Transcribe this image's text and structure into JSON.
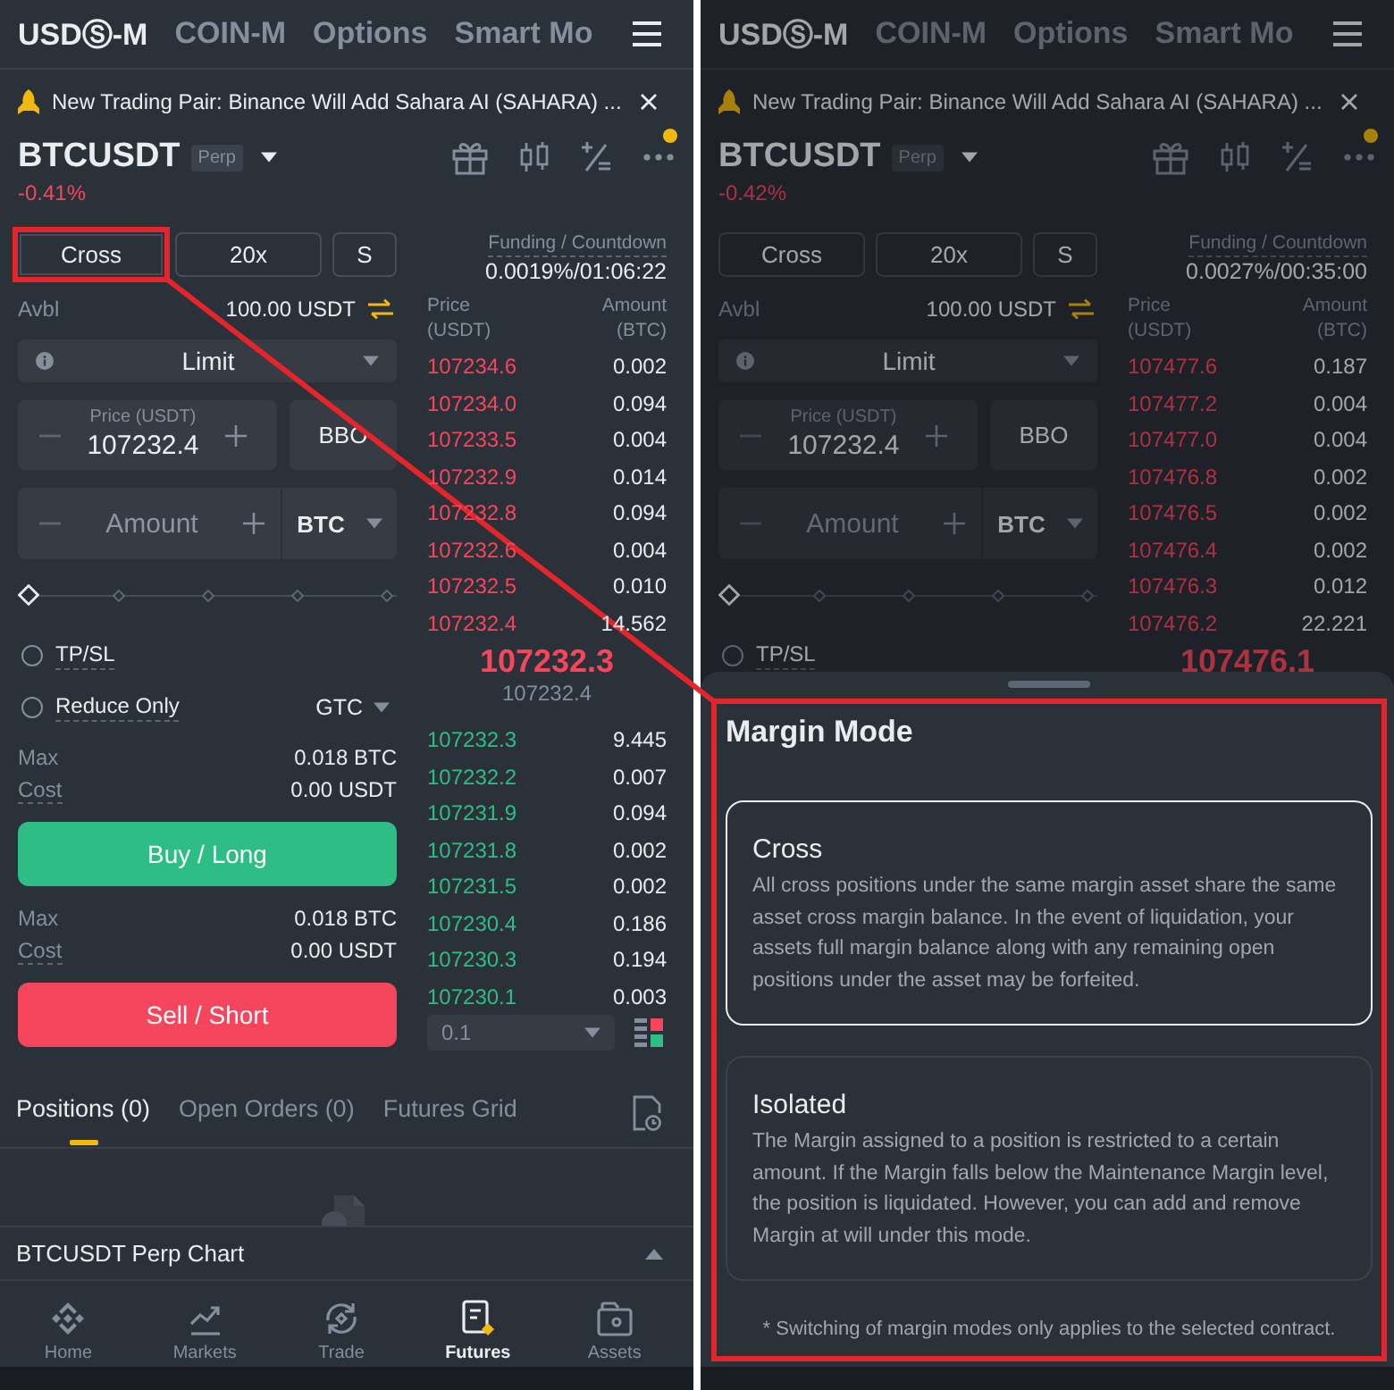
{
  "screens": [
    {
      "top_tabs": [
        {
          "label": "USDⓈ-M",
          "selected": true
        },
        {
          "label": "COIN-M",
          "selected": false
        },
        {
          "label": "Options",
          "selected": false
        },
        {
          "label": "Smart Mo",
          "selected": false
        }
      ],
      "announcement": "New Trading Pair: Binance Will Add Sahara AI (SAHARA) ...",
      "symbol": {
        "name": "BTCUSDT",
        "tag": "Perp",
        "change": "-0.41%"
      },
      "notice_dot": true,
      "margin_buttons": [
        {
          "label": "Cross",
          "highlighted": true
        },
        {
          "label": "20x",
          "highlighted": false
        },
        {
          "label": "S",
          "highlighted": false
        }
      ],
      "funding": {
        "label": "Funding / Countdown",
        "value": "0.0019%/01:06:22"
      },
      "available": {
        "label": "Avbl",
        "value": "100.00 USDT"
      },
      "order_type": "Limit",
      "price_field": {
        "label": "Price (USDT)",
        "value": "107232.4",
        "button": "BBO"
      },
      "amount_field": {
        "placeholder": "Amount",
        "unit": "BTC"
      },
      "slider": {
        "level": 0
      },
      "options": [
        {
          "label": "TP/SL",
          "checked": false
        },
        {
          "label": "Reduce Only",
          "checked": false,
          "time_in_force": "GTC"
        }
      ],
      "actions": [
        {
          "kind": "buy",
          "stats": [
            {
              "label": "Max",
              "value": "0.018 BTC"
            },
            {
              "label": "Cost",
              "value": "0.00 USDT"
            }
          ],
          "button": "Buy / Long"
        },
        {
          "kind": "sell",
          "stats": [
            {
              "label": "Max",
              "value": "0.018 BTC"
            },
            {
              "label": "Cost",
              "value": "0.00 USDT"
            }
          ],
          "button": "Sell / Short"
        }
      ],
      "order_book": {
        "columns": [
          {
            "label": "Price",
            "unit": "(USDT)"
          },
          {
            "label": "Amount",
            "unit": "(BTC)"
          }
        ],
        "asks": [
          {
            "price": "107234.6",
            "amount": "0.002"
          },
          {
            "price": "107234.0",
            "amount": "0.094"
          },
          {
            "price": "107233.5",
            "amount": "0.004"
          },
          {
            "price": "107232.9",
            "amount": "0.014"
          },
          {
            "price": "107232.8",
            "amount": "0.094"
          },
          {
            "price": "107232.6",
            "amount": "0.004"
          },
          {
            "price": "107232.5",
            "amount": "0.010"
          },
          {
            "price": "107232.4",
            "amount": "14.562"
          }
        ],
        "last_price": "107232.3",
        "mark_price": "107232.4",
        "bids": [
          {
            "price": "107232.3",
            "amount": "9.445"
          },
          {
            "price": "107232.2",
            "amount": "0.007"
          },
          {
            "price": "107231.9",
            "amount": "0.094"
          },
          {
            "price": "107231.8",
            "amount": "0.002"
          },
          {
            "price": "107231.5",
            "amount": "0.002"
          },
          {
            "price": "107230.4",
            "amount": "0.186"
          },
          {
            "price": "107230.3",
            "amount": "0.194"
          },
          {
            "price": "107230.1",
            "amount": "0.003"
          }
        ],
        "precision": "0.1"
      },
      "bottom_tabs": [
        {
          "label": "Positions (0)",
          "selected": true
        },
        {
          "label": "Open Orders (0)",
          "selected": false
        },
        {
          "label": "Futures Grid",
          "selected": false
        }
      ],
      "chart_section": "BTCUSDT Perp Chart",
      "nav": [
        {
          "label": "Home",
          "selected": false
        },
        {
          "label": "Markets",
          "selected": false
        },
        {
          "label": "Trade",
          "selected": false
        },
        {
          "label": "Futures",
          "selected": true
        },
        {
          "label": "Assets",
          "selected": false
        }
      ]
    },
    {
      "top_tabs": [
        {
          "label": "USDⓈ-M",
          "selected": true
        },
        {
          "label": "COIN-M",
          "selected": false
        },
        {
          "label": "Options",
          "selected": false
        },
        {
          "label": "Smart Mo",
          "selected": false
        }
      ],
      "announcement": "New Trading Pair: Binance Will Add Sahara AI (SAHARA) ...",
      "symbol": {
        "name": "BTCUSDT",
        "tag": "Perp",
        "change": "-0.42%"
      },
      "notice_dot": true,
      "margin_buttons": [
        {
          "label": "Cross",
          "highlighted": false
        },
        {
          "label": "20x",
          "highlighted": false
        },
        {
          "label": "S",
          "highlighted": false
        }
      ],
      "funding": {
        "label": "Funding / Countdown",
        "value": "0.0027%/00:35:00"
      },
      "available": {
        "label": "Avbl",
        "value": "100.00 USDT"
      },
      "order_type": "Limit",
      "price_field": {
        "label": "Price (USDT)",
        "value": "107232.4",
        "button": "BBO"
      },
      "amount_field": {
        "placeholder": "Amount",
        "unit": "BTC"
      },
      "slider": {
        "level": 0
      },
      "options": [
        {
          "label": "TP/SL",
          "checked": false
        }
      ],
      "order_book": {
        "columns": [
          {
            "label": "Price",
            "unit": "(USDT)"
          },
          {
            "label": "Amount",
            "unit": "(BTC)"
          }
        ],
        "asks": [
          {
            "price": "107477.6",
            "amount": "0.187"
          },
          {
            "price": "107477.2",
            "amount": "0.004"
          },
          {
            "price": "107477.0",
            "amount": "0.004"
          },
          {
            "price": "107476.8",
            "amount": "0.002"
          },
          {
            "price": "107476.5",
            "amount": "0.002"
          },
          {
            "price": "107476.4",
            "amount": "0.002"
          },
          {
            "price": "107476.3",
            "amount": "0.012"
          },
          {
            "price": "107476.2",
            "amount": "22.221"
          }
        ],
        "last_price": "107476.1"
      },
      "margin_mode_sheet": {
        "title": "Margin Mode",
        "highlighted": true,
        "options": [
          {
            "title": "Cross",
            "description": "All cross positions under the same margin asset share the same asset cross margin balance. In the event of liquidation, your assets full margin balance along with any remaining open positions under the asset may be forfeited.",
            "selected": true
          },
          {
            "title": "Isolated",
            "description": "The Margin assigned to a position is restricted to a certain amount. If the Margin falls below the Maintenance Margin level, the position is liquidated. However, you can add and remove Margin at will under this mode.",
            "selected": false
          }
        ],
        "note": "* Switching of margin modes only applies to the selected contract."
      }
    }
  ]
}
